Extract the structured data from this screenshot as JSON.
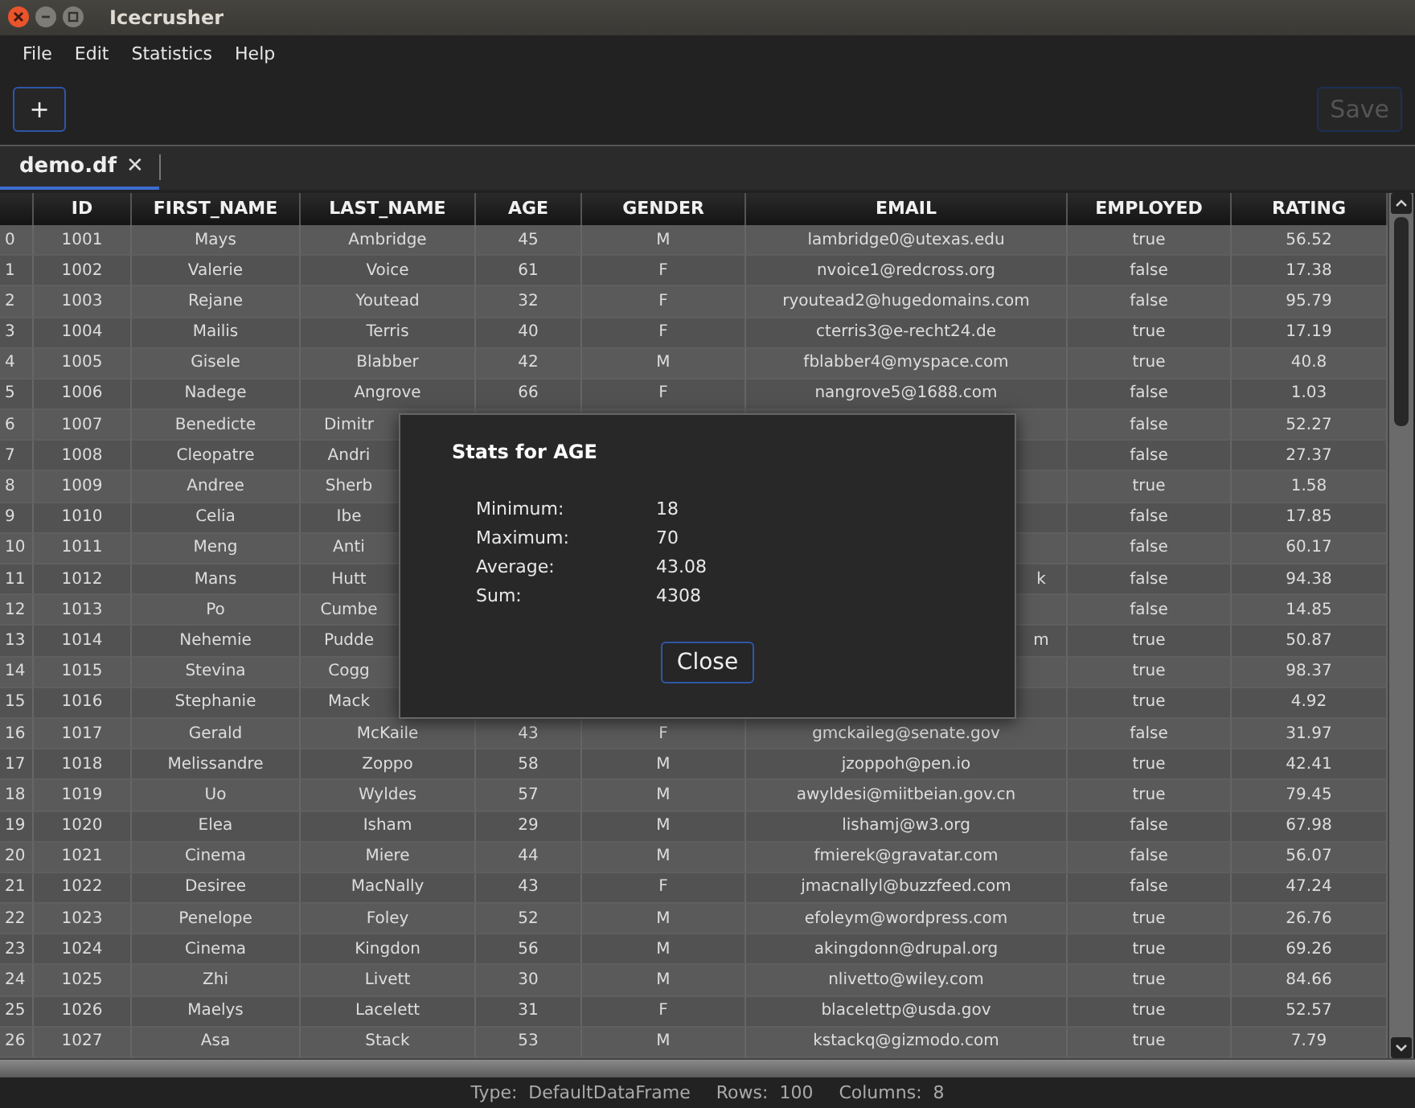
{
  "window": {
    "title": "Icecrusher"
  },
  "menu": [
    "File",
    "Edit",
    "Statistics",
    "Help"
  ],
  "toolbar": {
    "add": {
      "label": "+",
      "disabled": false
    },
    "save": {
      "label": "Save",
      "disabled": true
    }
  },
  "tabs": [
    {
      "label": "demo.df",
      "close": "✕",
      "selected": true
    }
  ],
  "table": {
    "columns": [
      "ID",
      "FIRST_NAME",
      "LAST_NAME",
      "AGE",
      "GENDER",
      "EMAIL",
      "EMPLOYED",
      "RATING"
    ],
    "rows": [
      {
        "row_number": "0",
        "cells": [
          "1001",
          "Mays",
          "Ambridge",
          "45",
          "M",
          "lambridge0@utexas.edu",
          "true",
          "56.52"
        ]
      },
      {
        "row_number": "1",
        "cells": [
          "1002",
          "Valerie",
          "Voice",
          "61",
          "F",
          "nvoice1@redcross.org",
          "false",
          "17.38"
        ]
      },
      {
        "row_number": "2",
        "cells": [
          "1003",
          "Rejane",
          "Youtead",
          "32",
          "F",
          "ryoutead2@hugedomains.com",
          "false",
          "95.79"
        ]
      },
      {
        "row_number": "3",
        "cells": [
          "1004",
          "Mailis",
          "Terris",
          "40",
          "F",
          "cterris3@e-recht24.de",
          "true",
          "17.19"
        ]
      },
      {
        "row_number": "4",
        "cells": [
          "1005",
          "Gisele",
          "Blabber",
          "42",
          "M",
          "fblabber4@myspace.com",
          "true",
          "40.8"
        ]
      },
      {
        "row_number": "5",
        "cells": [
          "1006",
          "Nadege",
          "Angrove",
          "66",
          "F",
          "nangrove5@1688.com",
          "false",
          "1.03"
        ]
      },
      {
        "row_number": "6",
        "cells": [
          "1007",
          "Benedicte",
          "Dimitr",
          null,
          null,
          null,
          "false",
          "52.27"
        ]
      },
      {
        "row_number": "7",
        "cells": [
          "1008",
          "Cleopatre",
          "Andri",
          null,
          null,
          null,
          "false",
          "27.37"
        ]
      },
      {
        "row_number": "8",
        "cells": [
          "1009",
          "Andree",
          "Sherb",
          null,
          null,
          null,
          "true",
          "1.58"
        ]
      },
      {
        "row_number": "9",
        "cells": [
          "1010",
          "Celia",
          "Ibe",
          null,
          null,
          null,
          "false",
          "17.85"
        ]
      },
      {
        "row_number": "10",
        "cells": [
          "1011",
          "Meng",
          "Anti",
          null,
          null,
          null,
          "false",
          "60.17"
        ]
      },
      {
        "row_number": "11",
        "cells": [
          "1012",
          "Mans",
          "Hutt",
          null,
          null,
          "k",
          "false",
          "94.38"
        ]
      },
      {
        "row_number": "12",
        "cells": [
          "1013",
          "Po",
          "Cumbe",
          null,
          null,
          null,
          "false",
          "14.85"
        ]
      },
      {
        "row_number": "13",
        "cells": [
          "1014",
          "Nehemie",
          "Pudde",
          null,
          null,
          "m",
          "true",
          "50.87"
        ]
      },
      {
        "row_number": "14",
        "cells": [
          "1015",
          "Stevina",
          "Cogg",
          null,
          null,
          null,
          "true",
          "98.37"
        ]
      },
      {
        "row_number": "15",
        "cells": [
          "1016",
          "Stephanie",
          "Mack",
          null,
          null,
          null,
          "true",
          "4.92"
        ]
      },
      {
        "row_number": "16",
        "cells": [
          "1017",
          "Gerald",
          "McKaile",
          "43",
          "F",
          "gmckaileg@senate.gov",
          "false",
          "31.97"
        ]
      },
      {
        "row_number": "17",
        "cells": [
          "1018",
          "Melissandre",
          "Zoppo",
          "58",
          "M",
          "jzoppoh@pen.io",
          "true",
          "42.41"
        ]
      },
      {
        "row_number": "18",
        "cells": [
          "1019",
          "Uo",
          "Wyldes",
          "57",
          "M",
          "awyldesi@miitbeian.gov.cn",
          "true",
          "79.45"
        ]
      },
      {
        "row_number": "19",
        "cells": [
          "1020",
          "Elea",
          "Isham",
          "29",
          "M",
          "lishamj@w3.org",
          "false",
          "67.98"
        ]
      },
      {
        "row_number": "20",
        "cells": [
          "1021",
          "Cinema",
          "Miere",
          "44",
          "M",
          "fmierek@gravatar.com",
          "false",
          "56.07"
        ]
      },
      {
        "row_number": "21",
        "cells": [
          "1022",
          "Desiree",
          "MacNally",
          "43",
          "F",
          "jmacnallyl@buzzfeed.com",
          "false",
          "47.24"
        ]
      },
      {
        "row_number": "22",
        "cells": [
          "1023",
          "Penelope",
          "Foley",
          "52",
          "M",
          "efoleym@wordpress.com",
          "true",
          "26.76"
        ]
      },
      {
        "row_number": "23",
        "cells": [
          "1024",
          "Cinema",
          "Kingdon",
          "56",
          "M",
          "akingdonn@drupal.org",
          "true",
          "69.26"
        ]
      },
      {
        "row_number": "24",
        "cells": [
          "1025",
          "Zhi",
          "Livett",
          "30",
          "M",
          "nlivetto@wiley.com",
          "true",
          "84.66"
        ]
      },
      {
        "row_number": "25",
        "cells": [
          "1026",
          "Maelys",
          "Lacelett",
          "31",
          "F",
          "blacelettp@usda.gov",
          "true",
          "52.57"
        ]
      },
      {
        "row_number": "26",
        "cells": [
          "1027",
          "Asa",
          "Stack",
          "53",
          "M",
          "kstackq@gizmodo.com",
          "true",
          "7.79"
        ]
      }
    ]
  },
  "dialog": {
    "title": "Stats for AGE",
    "stats": [
      {
        "label": "Minimum:",
        "value": "18"
      },
      {
        "label": "Maximum:",
        "value": "70"
      },
      {
        "label": "Average:",
        "value": "43.08"
      },
      {
        "label": "Sum:",
        "value": "4308"
      }
    ],
    "button": "Close"
  },
  "status_bar": [
    {
      "label": "Type:",
      "value": "DefaultDataFrame"
    },
    {
      "label": "Rows:",
      "value": "100"
    },
    {
      "label": "Columns:",
      "value": "8"
    }
  ]
}
